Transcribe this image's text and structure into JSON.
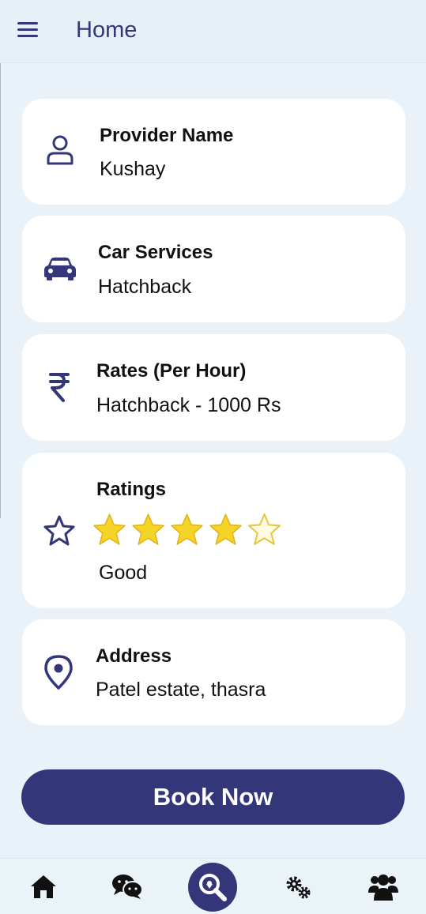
{
  "header": {
    "title": "Home",
    "menu_icon": "menu-icon"
  },
  "cards": {
    "provider": {
      "label": "Provider Name",
      "value": "Kushay",
      "icon": "user-icon"
    },
    "car": {
      "label": "Car Services",
      "value": "Hatchback",
      "icon": "car-icon"
    },
    "rates": {
      "label": "Rates (Per Hour)",
      "value": "Hatchback - 1000 Rs",
      "icon": "rupee-icon"
    },
    "ratings": {
      "label": "Ratings",
      "value": "Good",
      "icon": "star-outline-icon",
      "stars_filled": 4,
      "stars_total": 5
    },
    "address": {
      "label": "Address",
      "value": "Patel estate, thasra",
      "icon": "location-pin-icon"
    }
  },
  "actions": {
    "book_label": "Book Now"
  },
  "bottom_nav": {
    "items": [
      "home-icon",
      "chat-icon",
      "search-icon",
      "settings-icon",
      "users-icon"
    ],
    "active": "search-icon"
  },
  "colors": {
    "accent": "#33377a",
    "background": "#e8f2f8",
    "card": "#ffffff",
    "star": "#f5d327"
  }
}
